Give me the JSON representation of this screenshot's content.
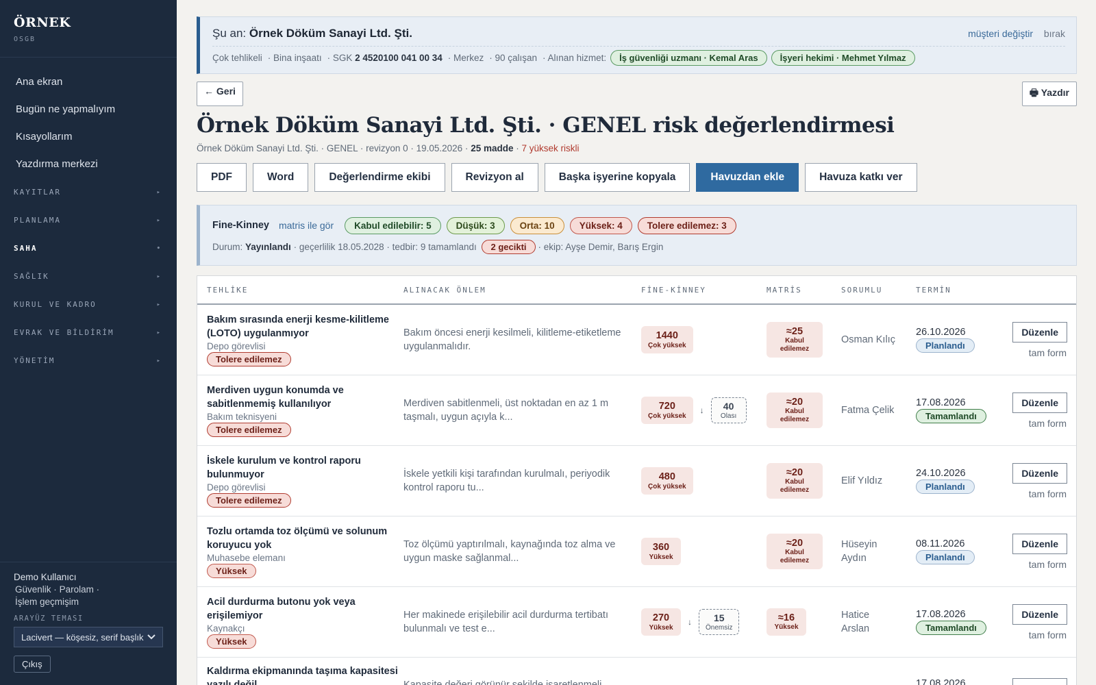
{
  "sidebar": {
    "brand": "ÖRNEK",
    "brand_sub": "OSGB",
    "main_items": [
      "Ana ekran",
      "Bugün ne yapmalıyım",
      "Kısayollarım",
      "Yazdırma merkezi"
    ],
    "sections": [
      {
        "label": "KAYITLAR",
        "arrow": "▸"
      },
      {
        "label": "PLANLAMA",
        "arrow": "▸"
      },
      {
        "label": "SAHA",
        "arrow": "•"
      },
      {
        "label": "SAĞLIK",
        "arrow": "▸"
      },
      {
        "label": "KURUL VE KADRO",
        "arrow": "▸"
      },
      {
        "label": "EVRAK VE BİLDİRİM",
        "arrow": "▸"
      },
      {
        "label": "YÖNETİM",
        "arrow": "▸"
      }
    ],
    "active_section": "SAHA",
    "user_name": "Demo Kullanıcı",
    "user_links": {
      "security": "Güvenlik",
      "password": "Parolam",
      "history": "İşlem geçmişim",
      "sep": "·"
    },
    "theme_label": "ARAYÜZ TEMASI",
    "theme_value": "Lacivert — köşesiz, serif başlık",
    "logout": "Çıkış"
  },
  "context": {
    "prefix": "Şu an:",
    "company": "Örnek Döküm Sanayi Ltd. Şti.",
    "change_link": "müşteri değiştir",
    "leave_link": "bırak",
    "hazard_class": "Çok tehlikeli",
    "sector": "· Bina inşaatı",
    "sgk_prefix": "· SGK",
    "sgk": "2 4520100 041 00 34",
    "branch": "· Merkez",
    "employees": "· 90 çalışan",
    "service_label": "· Alınan hizmet:",
    "services": [
      "İş güvenliği uzmanı · Kemal Aras",
      "İşyeri hekimi · Mehmet Yılmaz"
    ]
  },
  "toolbar": {
    "back": "← Geri",
    "print": "🖶 Yazdır"
  },
  "page": {
    "title": "Örnek Döküm Sanayi Ltd. Şti. · GENEL risk değerlendirmesi",
    "sub_prefix": "Örnek Döküm Sanayi Ltd. Şti. · GENEL · revizyon 0 · 19.05.2026 ·",
    "sub_items": "25 madde",
    "sub_sep": "·",
    "sub_high": "7 yüksek riskli"
  },
  "actions": [
    "PDF",
    "Word",
    "Değerlendirme ekibi",
    "Revizyon al",
    "Başka işyerine kopyala",
    "Havuzdan ekle",
    "Havuza katkı ver"
  ],
  "summary": {
    "method": "Fine-Kinney",
    "matrix_link": "matris ile gör",
    "chips": {
      "kabul": "Kabul edilebilir: 5",
      "dusuk": "Düşük: 3",
      "orta": "Orta: 10",
      "yuksek": "Yüksek: 4",
      "tolere": "Tolere edilemez: 3"
    },
    "status_label": "Durum:",
    "status_value": "Yayınlandı",
    "validity": "· geçerlilik 18.05.2028 · tedbir: 9 tamamlandı",
    "late": "2 gecikti",
    "team": "· ekip: Ayşe Demir, Barış Ergin"
  },
  "table": {
    "headers": [
      "TEHLİKE",
      "ALINACAK ÖNLEM",
      "FİNE-KİNNEY",
      "MATRİS",
      "SORUMLU",
      "TERMİN"
    ],
    "edit_label": "Düzenle",
    "full_form_label": "tam form",
    "rows": [
      {
        "hazard": "Bakım sırasında enerji kesme-kilitleme (LOTO) uygulanmıyor",
        "role": "Depo görevlisi",
        "level": "Tolere edilemez",
        "measure": "Bakım öncesi enerji kesilmeli, kilitleme-etiketleme uygulanmalıdır.",
        "fk_score": "1440",
        "fk_label": "Çok yüksek",
        "matrix_score": "≈25",
        "matrix_label": "Kabul edilemez",
        "responsible": "Osman Kılıç",
        "due": "26.10.2026",
        "status": "Planlandı"
      },
      {
        "hazard": "Merdiven uygun konumda ve sabitlenmemiş kullanılıyor",
        "role": "Bakım teknisyeni",
        "level": "Tolere edilemez",
        "measure": "Merdiven sabitlenmeli, üst noktadan en az 1 m taşmalı, uygun açıyla k...",
        "fk_score": "720",
        "fk_label": "Çok yüksek",
        "fk_arrow": "↓",
        "fk_after_score": "40",
        "fk_after_label": "Olası",
        "matrix_score": "≈20",
        "matrix_label": "Kabul edilemez",
        "responsible": "Fatma Çelik",
        "due": "17.08.2026",
        "status": "Tamamlandı"
      },
      {
        "hazard": "İskele kurulum ve kontrol raporu bulunmuyor",
        "role": "Depo görevlisi",
        "level": "Tolere edilemez",
        "measure": "İskele yetkili kişi tarafından kurulmalı, periyodik kontrol raporu tu...",
        "fk_score": "480",
        "fk_label": "Çok yüksek",
        "matrix_score": "≈20",
        "matrix_label": "Kabul edilemez",
        "responsible": "Elif Yıldız",
        "due": "24.10.2026",
        "status": "Planlandı"
      },
      {
        "hazard": "Tozlu ortamda toz ölçümü ve solunum koruyucu yok",
        "role": "Muhasebe elemanı",
        "level": "Yüksek",
        "measure": "Toz ölçümü yaptırılmalı, kaynağında toz alma ve uygun maske sağlanmal...",
        "fk_score": "360",
        "fk_label": "Yüksek",
        "matrix_score": "≈20",
        "matrix_label": "Kabul edilemez",
        "responsible": "Hüseyin Aydın",
        "due": "08.11.2026",
        "status": "Planlandı"
      },
      {
        "hazard": "Acil durdurma butonu yok veya erişilemiyor",
        "role": "Kaynakçı",
        "level": "Yüksek",
        "measure": "Her makinede erişilebilir acil durdurma tertibatı bulunmalı ve test e...",
        "fk_score": "270",
        "fk_label": "Yüksek",
        "fk_arrow": "↓",
        "fk_after_score": "15",
        "fk_after_label": "Önemsiz",
        "matrix_score": "≈16",
        "matrix_label": "Yüksek",
        "responsible": "Hatice Arslan",
        "due": "17.08.2026",
        "status": "Tamamlandı"
      },
      {
        "hazard": "Kaldırma ekipmanında taşıma kapasitesi yazılı değil",
        "measure": "Kapasite değeri görünür şekilde işaretlenmeli...",
        "due": "17.08.2026"
      }
    ]
  }
}
